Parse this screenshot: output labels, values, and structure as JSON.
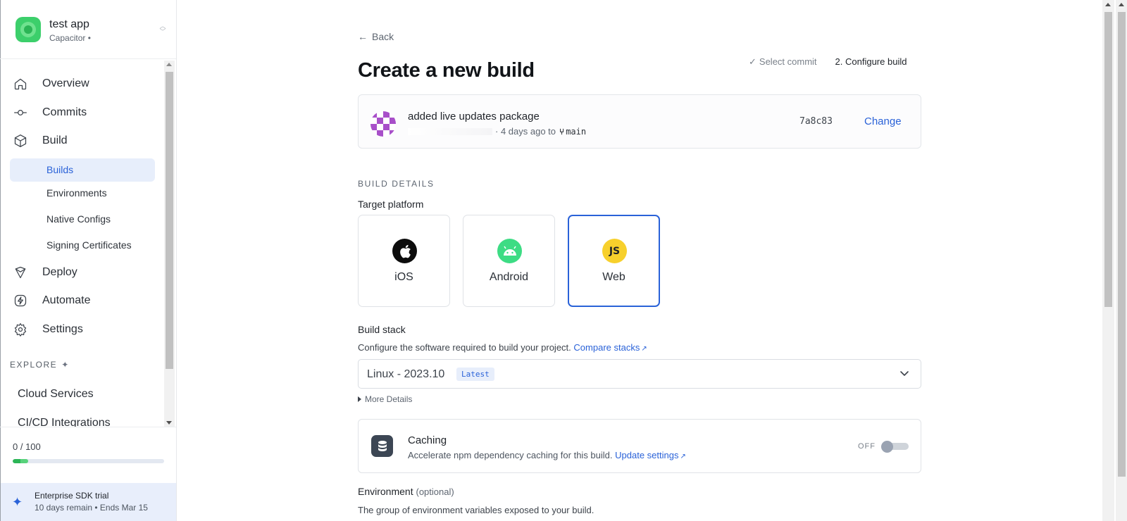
{
  "app": {
    "name": "test app",
    "subtitle": "Capacitor •"
  },
  "sidebar": {
    "nav": [
      {
        "label": "Overview",
        "icon": "home-icon"
      },
      {
        "label": "Commits",
        "icon": "commit-icon"
      },
      {
        "label": "Build",
        "icon": "cube-icon"
      },
      {
        "label": "Deploy",
        "icon": "deploy-icon"
      },
      {
        "label": "Automate",
        "icon": "bolt-icon"
      },
      {
        "label": "Settings",
        "icon": "gear-icon"
      }
    ],
    "build_sub": [
      "Builds",
      "Environments",
      "Native Configs",
      "Signing Certificates"
    ],
    "explore_label": "EXPLORE",
    "explore_items": [
      "Cloud Services",
      "CI/CD Integrations"
    ],
    "usage": {
      "text": "0 / 100",
      "fraction": 0.1
    },
    "trial": {
      "title": "Enterprise SDK trial",
      "subtitle": "10 days remain • Ends Mar 15"
    }
  },
  "main": {
    "back_label": "Back",
    "title": "Create a new build",
    "steps": {
      "step1": "Select commit",
      "step2": "2. Configure build"
    },
    "commit": {
      "message": "added live updates package",
      "meta": "· 4 days ago to",
      "branch": "main",
      "sha": "7a8c83",
      "change_label": "Change"
    },
    "section_label": "BUILD DETAILS",
    "target_platform_label": "Target platform",
    "platforms": [
      {
        "label": "iOS",
        "selected": false
      },
      {
        "label": "Android",
        "selected": false
      },
      {
        "label": "Web",
        "selected": true
      }
    ],
    "build_stack": {
      "label": "Build stack",
      "help": "Configure the software required to build your project.",
      "help_link": "Compare stacks",
      "value": "Linux - 2023.10",
      "badge": "Latest",
      "more_details": "More Details"
    },
    "caching": {
      "title": "Caching",
      "desc": "Accelerate npm dependency caching for this build.",
      "link": "Update settings",
      "toggle_label": "OFF",
      "enabled": false
    },
    "environment": {
      "label": "Environment",
      "optional": "(optional)",
      "help": "The group of environment variables exposed to your build."
    }
  },
  "colors": {
    "accent": "#2a62d8",
    "app_logo": "#3ccf6b",
    "android": "#3ddc84",
    "js": "#f7d02c"
  }
}
